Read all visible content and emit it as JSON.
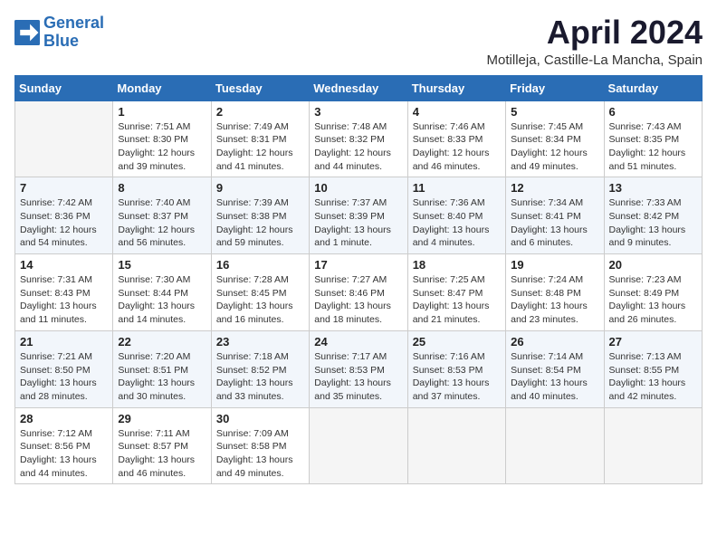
{
  "header": {
    "logo_line1": "General",
    "logo_line2": "Blue",
    "month_title": "April 2024",
    "subtitle": "Motilleja, Castille-La Mancha, Spain"
  },
  "weekdays": [
    "Sunday",
    "Monday",
    "Tuesday",
    "Wednesday",
    "Thursday",
    "Friday",
    "Saturday"
  ],
  "weeks": [
    [
      {
        "day": "",
        "sunrise": "",
        "sunset": "",
        "daylight": ""
      },
      {
        "day": "1",
        "sunrise": "Sunrise: 7:51 AM",
        "sunset": "Sunset: 8:30 PM",
        "daylight": "Daylight: 12 hours and 39 minutes."
      },
      {
        "day": "2",
        "sunrise": "Sunrise: 7:49 AM",
        "sunset": "Sunset: 8:31 PM",
        "daylight": "Daylight: 12 hours and 41 minutes."
      },
      {
        "day": "3",
        "sunrise": "Sunrise: 7:48 AM",
        "sunset": "Sunset: 8:32 PM",
        "daylight": "Daylight: 12 hours and 44 minutes."
      },
      {
        "day": "4",
        "sunrise": "Sunrise: 7:46 AM",
        "sunset": "Sunset: 8:33 PM",
        "daylight": "Daylight: 12 hours and 46 minutes."
      },
      {
        "day": "5",
        "sunrise": "Sunrise: 7:45 AM",
        "sunset": "Sunset: 8:34 PM",
        "daylight": "Daylight: 12 hours and 49 minutes."
      },
      {
        "day": "6",
        "sunrise": "Sunrise: 7:43 AM",
        "sunset": "Sunset: 8:35 PM",
        "daylight": "Daylight: 12 hours and 51 minutes."
      }
    ],
    [
      {
        "day": "7",
        "sunrise": "Sunrise: 7:42 AM",
        "sunset": "Sunset: 8:36 PM",
        "daylight": "Daylight: 12 hours and 54 minutes."
      },
      {
        "day": "8",
        "sunrise": "Sunrise: 7:40 AM",
        "sunset": "Sunset: 8:37 PM",
        "daylight": "Daylight: 12 hours and 56 minutes."
      },
      {
        "day": "9",
        "sunrise": "Sunrise: 7:39 AM",
        "sunset": "Sunset: 8:38 PM",
        "daylight": "Daylight: 12 hours and 59 minutes."
      },
      {
        "day": "10",
        "sunrise": "Sunrise: 7:37 AM",
        "sunset": "Sunset: 8:39 PM",
        "daylight": "Daylight: 13 hours and 1 minute."
      },
      {
        "day": "11",
        "sunrise": "Sunrise: 7:36 AM",
        "sunset": "Sunset: 8:40 PM",
        "daylight": "Daylight: 13 hours and 4 minutes."
      },
      {
        "day": "12",
        "sunrise": "Sunrise: 7:34 AM",
        "sunset": "Sunset: 8:41 PM",
        "daylight": "Daylight: 13 hours and 6 minutes."
      },
      {
        "day": "13",
        "sunrise": "Sunrise: 7:33 AM",
        "sunset": "Sunset: 8:42 PM",
        "daylight": "Daylight: 13 hours and 9 minutes."
      }
    ],
    [
      {
        "day": "14",
        "sunrise": "Sunrise: 7:31 AM",
        "sunset": "Sunset: 8:43 PM",
        "daylight": "Daylight: 13 hours and 11 minutes."
      },
      {
        "day": "15",
        "sunrise": "Sunrise: 7:30 AM",
        "sunset": "Sunset: 8:44 PM",
        "daylight": "Daylight: 13 hours and 14 minutes."
      },
      {
        "day": "16",
        "sunrise": "Sunrise: 7:28 AM",
        "sunset": "Sunset: 8:45 PM",
        "daylight": "Daylight: 13 hours and 16 minutes."
      },
      {
        "day": "17",
        "sunrise": "Sunrise: 7:27 AM",
        "sunset": "Sunset: 8:46 PM",
        "daylight": "Daylight: 13 hours and 18 minutes."
      },
      {
        "day": "18",
        "sunrise": "Sunrise: 7:25 AM",
        "sunset": "Sunset: 8:47 PM",
        "daylight": "Daylight: 13 hours and 21 minutes."
      },
      {
        "day": "19",
        "sunrise": "Sunrise: 7:24 AM",
        "sunset": "Sunset: 8:48 PM",
        "daylight": "Daylight: 13 hours and 23 minutes."
      },
      {
        "day": "20",
        "sunrise": "Sunrise: 7:23 AM",
        "sunset": "Sunset: 8:49 PM",
        "daylight": "Daylight: 13 hours and 26 minutes."
      }
    ],
    [
      {
        "day": "21",
        "sunrise": "Sunrise: 7:21 AM",
        "sunset": "Sunset: 8:50 PM",
        "daylight": "Daylight: 13 hours and 28 minutes."
      },
      {
        "day": "22",
        "sunrise": "Sunrise: 7:20 AM",
        "sunset": "Sunset: 8:51 PM",
        "daylight": "Daylight: 13 hours and 30 minutes."
      },
      {
        "day": "23",
        "sunrise": "Sunrise: 7:18 AM",
        "sunset": "Sunset: 8:52 PM",
        "daylight": "Daylight: 13 hours and 33 minutes."
      },
      {
        "day": "24",
        "sunrise": "Sunrise: 7:17 AM",
        "sunset": "Sunset: 8:53 PM",
        "daylight": "Daylight: 13 hours and 35 minutes."
      },
      {
        "day": "25",
        "sunrise": "Sunrise: 7:16 AM",
        "sunset": "Sunset: 8:53 PM",
        "daylight": "Daylight: 13 hours and 37 minutes."
      },
      {
        "day": "26",
        "sunrise": "Sunrise: 7:14 AM",
        "sunset": "Sunset: 8:54 PM",
        "daylight": "Daylight: 13 hours and 40 minutes."
      },
      {
        "day": "27",
        "sunrise": "Sunrise: 7:13 AM",
        "sunset": "Sunset: 8:55 PM",
        "daylight": "Daylight: 13 hours and 42 minutes."
      }
    ],
    [
      {
        "day": "28",
        "sunrise": "Sunrise: 7:12 AM",
        "sunset": "Sunset: 8:56 PM",
        "daylight": "Daylight: 13 hours and 44 minutes."
      },
      {
        "day": "29",
        "sunrise": "Sunrise: 7:11 AM",
        "sunset": "Sunset: 8:57 PM",
        "daylight": "Daylight: 13 hours and 46 minutes."
      },
      {
        "day": "30",
        "sunrise": "Sunrise: 7:09 AM",
        "sunset": "Sunset: 8:58 PM",
        "daylight": "Daylight: 13 hours and 49 minutes."
      },
      {
        "day": "",
        "sunrise": "",
        "sunset": "",
        "daylight": ""
      },
      {
        "day": "",
        "sunrise": "",
        "sunset": "",
        "daylight": ""
      },
      {
        "day": "",
        "sunrise": "",
        "sunset": "",
        "daylight": ""
      },
      {
        "day": "",
        "sunrise": "",
        "sunset": "",
        "daylight": ""
      }
    ]
  ]
}
